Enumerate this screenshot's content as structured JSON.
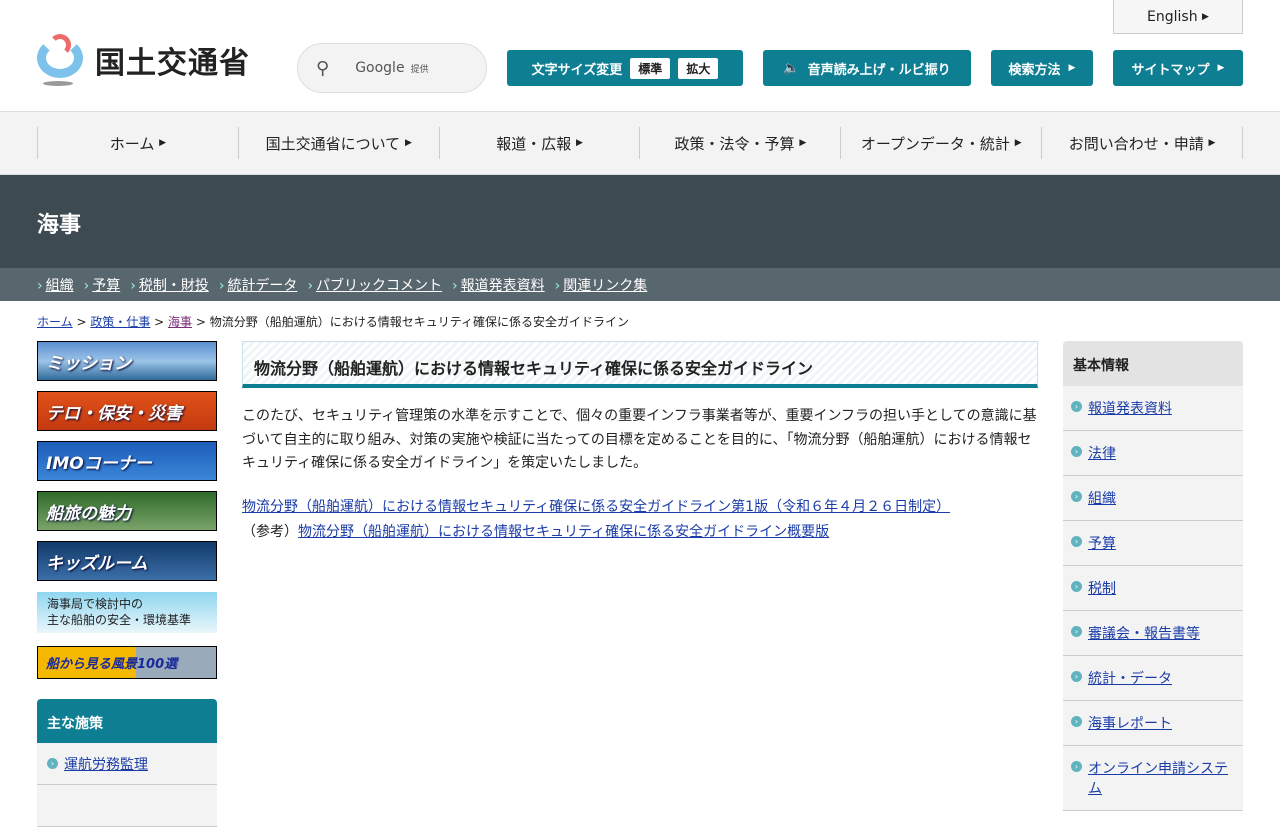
{
  "header": {
    "logo_text": "国土交通省",
    "search_provider": "Google",
    "search_suffix": "提供",
    "english": "English",
    "font_size_label": "文字サイズ変更",
    "font_standard": "標準",
    "font_large": "拡大",
    "speech": "音声読み上げ・ルビ振り",
    "search_method": "検索方法",
    "sitemap": "サイトマップ"
  },
  "nav": [
    "ホーム",
    "国土交通省について",
    "報道・広報",
    "政策・法令・予算",
    "オープンデータ・統計",
    "お問い合わせ・申請"
  ],
  "section_title": "海事",
  "subnav": [
    "組織",
    "予算",
    "税制・財投",
    "統計データ",
    "パブリックコメント",
    "報道発表資料",
    "関連リンク集"
  ],
  "breadcrumb": {
    "home": "ホーム",
    "policy": "政策・仕事",
    "maritime": "海事",
    "current": "物流分野（船舶運航）における情報セキュリティ確保に係る安全ガイドライン"
  },
  "banners": [
    "ミッション",
    "テロ・保安・災害",
    "IMOコーナー",
    "船旅の魅力",
    "キッズルーム",
    "海事局で検討中の\n主な船舶の安全・環境基準",
    "船から見る風景100選"
  ],
  "left_menu": {
    "title": "主な施策",
    "items": [
      "運航労務監理"
    ]
  },
  "main": {
    "title": "物流分野（船舶運航）における情報セキュリティ確保に係る安全ガイドライン",
    "body": "このたび、セキュリティ管理策の水準を示すことで、個々の重要インフラ事業者等が、重要インフラの担い手としての意識に基づいて自主的に取り組み、対策の実施や検証に当たっての目標を定めることを目的に、「物流分野（船舶運航）における情報セキュリティ確保に係る安全ガイドライン」を策定いたしました。",
    "link1": "物流分野（船舶運航）における情報セキュリティ確保に係る安全ガイドライン第1版（令和６年４月２６日制定）",
    "ref_prefix": "（参考）",
    "link2": "物流分野（船舶運航）における情報セキュリティ確保に係る安全ガイドライン概要版"
  },
  "right_menu": {
    "title": "基本情報",
    "items": [
      "報道発表資料",
      "法律",
      "組織",
      "予算",
      "税制",
      "審議会・報告書等",
      "統計・データ",
      "海事レポート",
      "オンライン申請システム"
    ]
  }
}
